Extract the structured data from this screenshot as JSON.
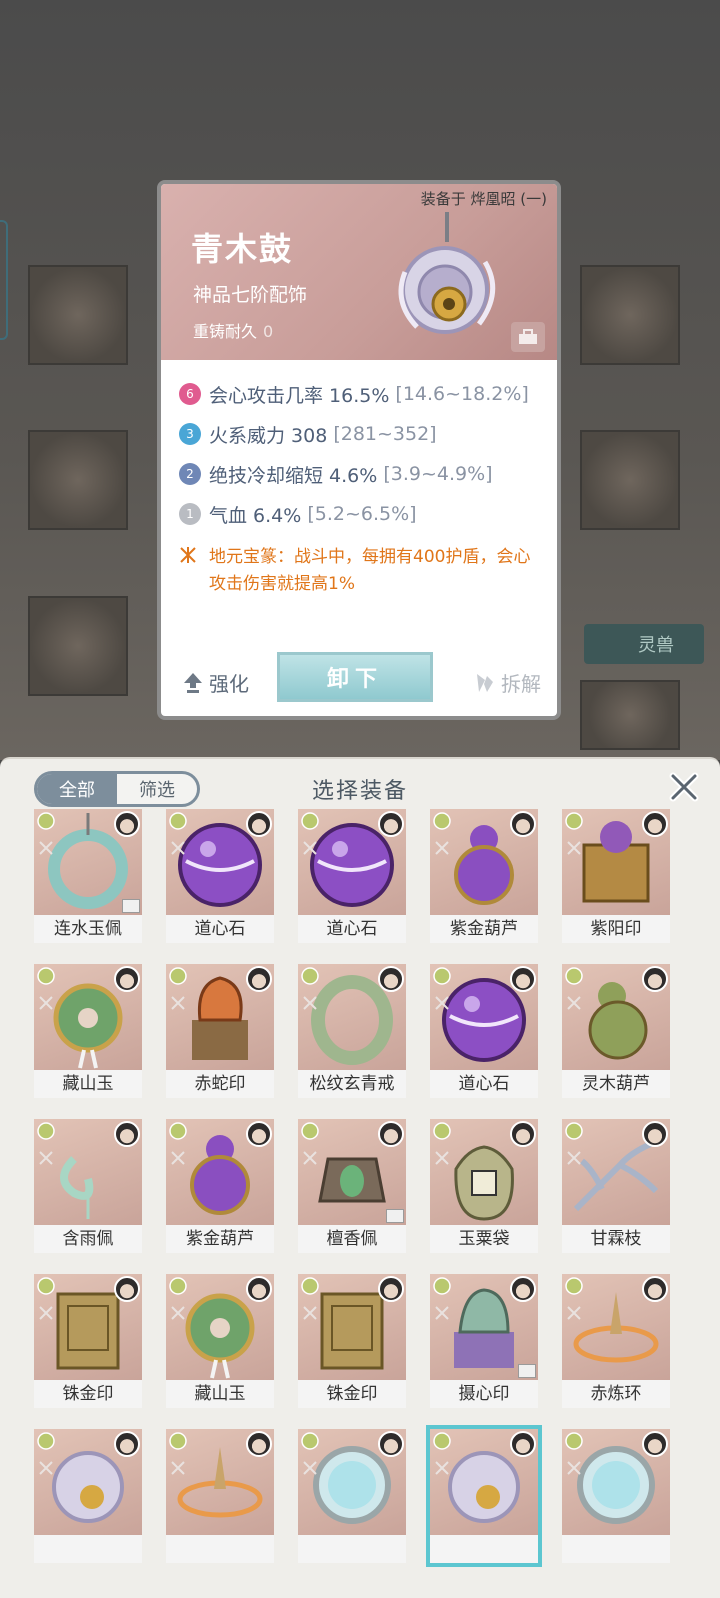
{
  "detail": {
    "equipped_on": "装备于 烨凰昭 (一)",
    "name": "青木鼓",
    "grade": "神品七阶配饰",
    "recast_label": "重铸耐久",
    "recast_value": "0",
    "stats": [
      {
        "badge": "6",
        "color": "#e05b8f",
        "text": "会心攻击几率 16.5%",
        "range": "[14.6~18.2%]"
      },
      {
        "badge": "3",
        "color": "#4aa6d6",
        "text": "火系威力 308",
        "range": "[281~352]"
      },
      {
        "badge": "2",
        "color": "#6f87b6",
        "text": "绝技冷却缩短 4.6%",
        "range": "[3.9~4.9%]"
      },
      {
        "badge": "1",
        "color": "#b9bcc2",
        "text": "气血 6.4%",
        "range": "[5.2~6.5%]"
      }
    ],
    "effect": "地元宝篆：战斗中，每拥有400护盾，会心攻击伤害就提高1%",
    "actions": {
      "enhance": "强化",
      "unequip": "卸下",
      "dismantle": "拆解"
    }
  },
  "background": {
    "tab_label": "灵兽"
  },
  "panel": {
    "filter_all": "全部",
    "filter_screen": "筛选",
    "title": "选择装备",
    "items": [
      {
        "name": "连水玉佩",
        "art": "pendant-jade",
        "tag": true
      },
      {
        "name": "道心石",
        "art": "purple-orb"
      },
      {
        "name": "道心石",
        "art": "purple-orb"
      },
      {
        "name": "紫金葫芦",
        "art": "gourd-purple"
      },
      {
        "name": "紫阳印",
        "art": "seal-purple"
      },
      {
        "name": "藏山玉",
        "art": "jade-disc"
      },
      {
        "name": "赤蛇印",
        "art": "seal-red"
      },
      {
        "name": "松纹玄青戒",
        "art": "ring-green"
      },
      {
        "name": "道心石",
        "art": "purple-orb"
      },
      {
        "name": "灵木葫芦",
        "art": "gourd-green"
      },
      {
        "name": "含雨佩",
        "art": "pendant-rain"
      },
      {
        "name": "紫金葫芦",
        "art": "gourd-purple"
      },
      {
        "name": "檀香佩",
        "art": "pendant-sandal",
        "tag": true
      },
      {
        "name": "玉粟袋",
        "art": "bag"
      },
      {
        "name": "甘霖枝",
        "art": "branch"
      },
      {
        "name": "铢金印",
        "art": "seal-gold"
      },
      {
        "name": "藏山玉",
        "art": "jade-disc"
      },
      {
        "name": "铢金印",
        "art": "seal-gold"
      },
      {
        "name": "摄心印",
        "art": "seal-violet",
        "tag": true
      },
      {
        "name": "赤炼环",
        "art": "ring-fire"
      },
      {
        "name": "",
        "art": "pendant-silver"
      },
      {
        "name": "",
        "art": "ring-fire"
      },
      {
        "name": "",
        "art": "mirror"
      },
      {
        "name": "",
        "art": "pendant-silver",
        "selected": true
      },
      {
        "name": "",
        "art": "mirror"
      }
    ]
  }
}
